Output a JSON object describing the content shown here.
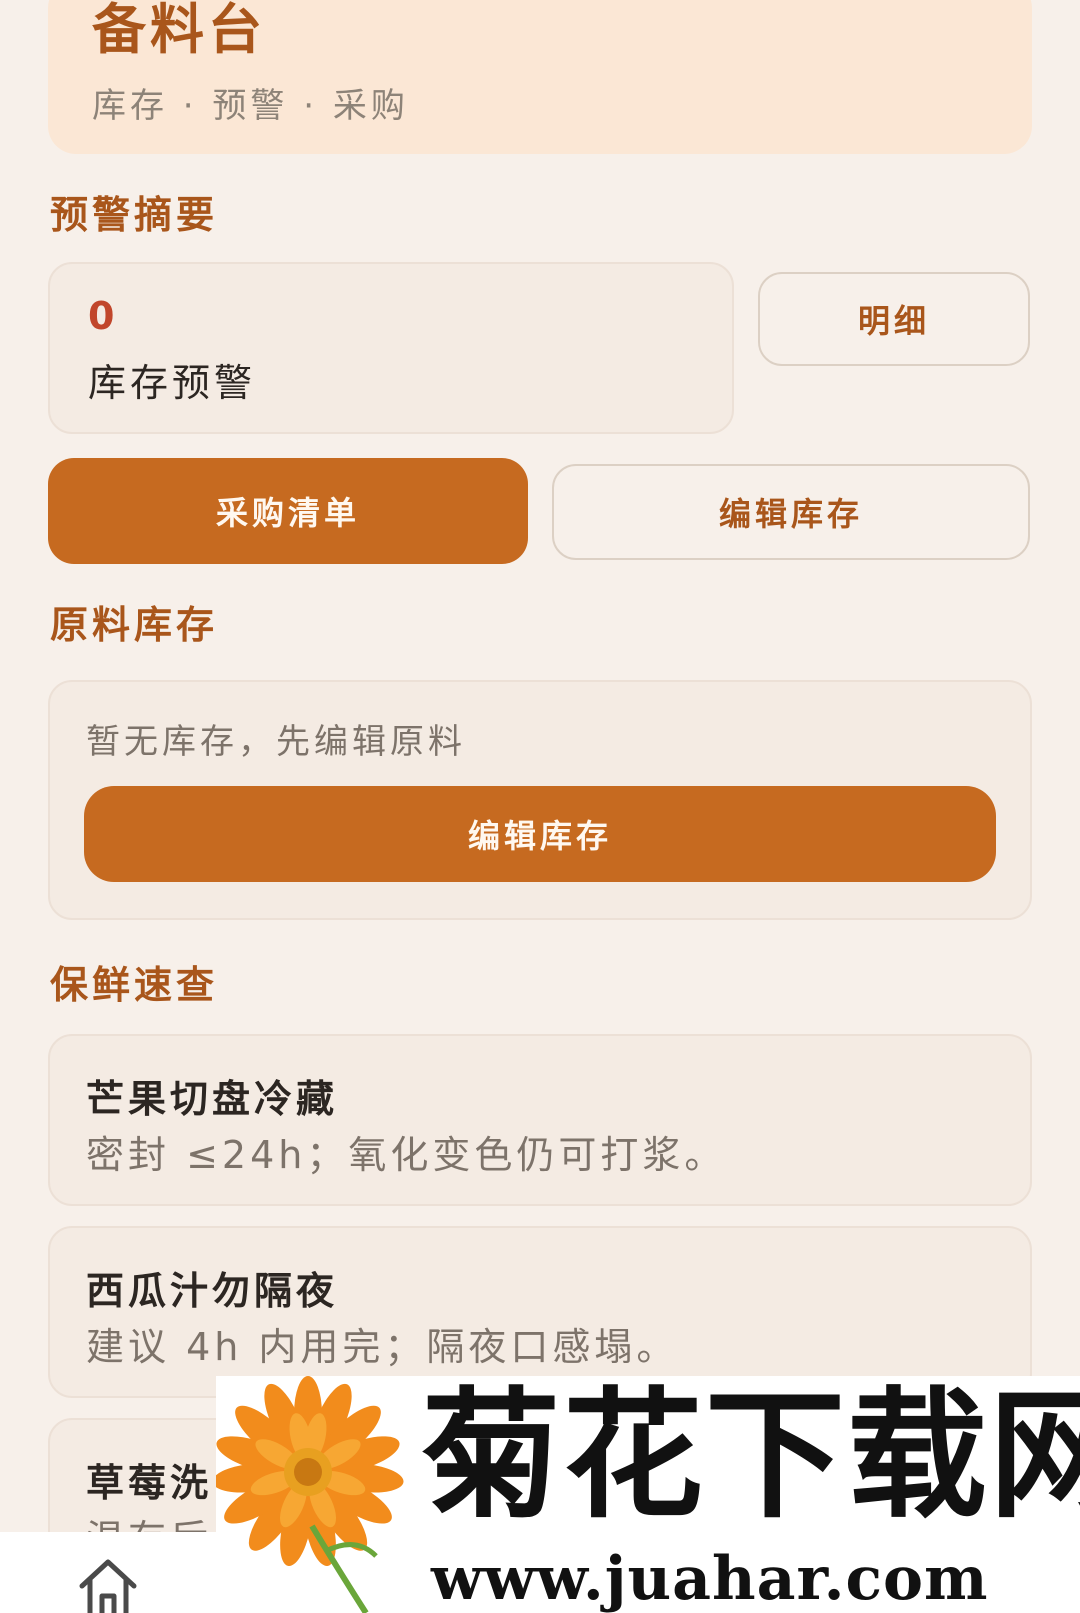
{
  "header": {
    "title": "备料台",
    "subtitle": "库存 · 预警 · 采购"
  },
  "alerts": {
    "section_title": "预警摘要",
    "count": "0",
    "label": "库存预警",
    "detail_button": "明细"
  },
  "actions": {
    "purchase_list": "采购清单",
    "edit_stock": "编辑库存"
  },
  "stock": {
    "section_title": "原料库存",
    "empty_text": "暂无库存，先编辑原料",
    "edit_button": "编辑库存"
  },
  "freshness": {
    "section_title": "保鲜速查",
    "items": [
      {
        "title": "芒果切盘冷藏",
        "desc": "密封 ≤24h；氧化变色仍可打浆。"
      },
      {
        "title": "西瓜汁勿隔夜",
        "desc": "建议 4h 内用完；隔夜口感塌。"
      },
      {
        "title": "草莓洗",
        "desc": "温存后"
      }
    ]
  },
  "bottom_nav": {
    "home_icon": "home-icon"
  },
  "watermark": {
    "title": "菊花下载网",
    "url": "www.juahar.com",
    "icon": "flower-icon"
  },
  "colors": {
    "accent": "#c66a20",
    "heading": "#a9561b",
    "alert": "#c1462b",
    "background": "#f7f0ea"
  }
}
